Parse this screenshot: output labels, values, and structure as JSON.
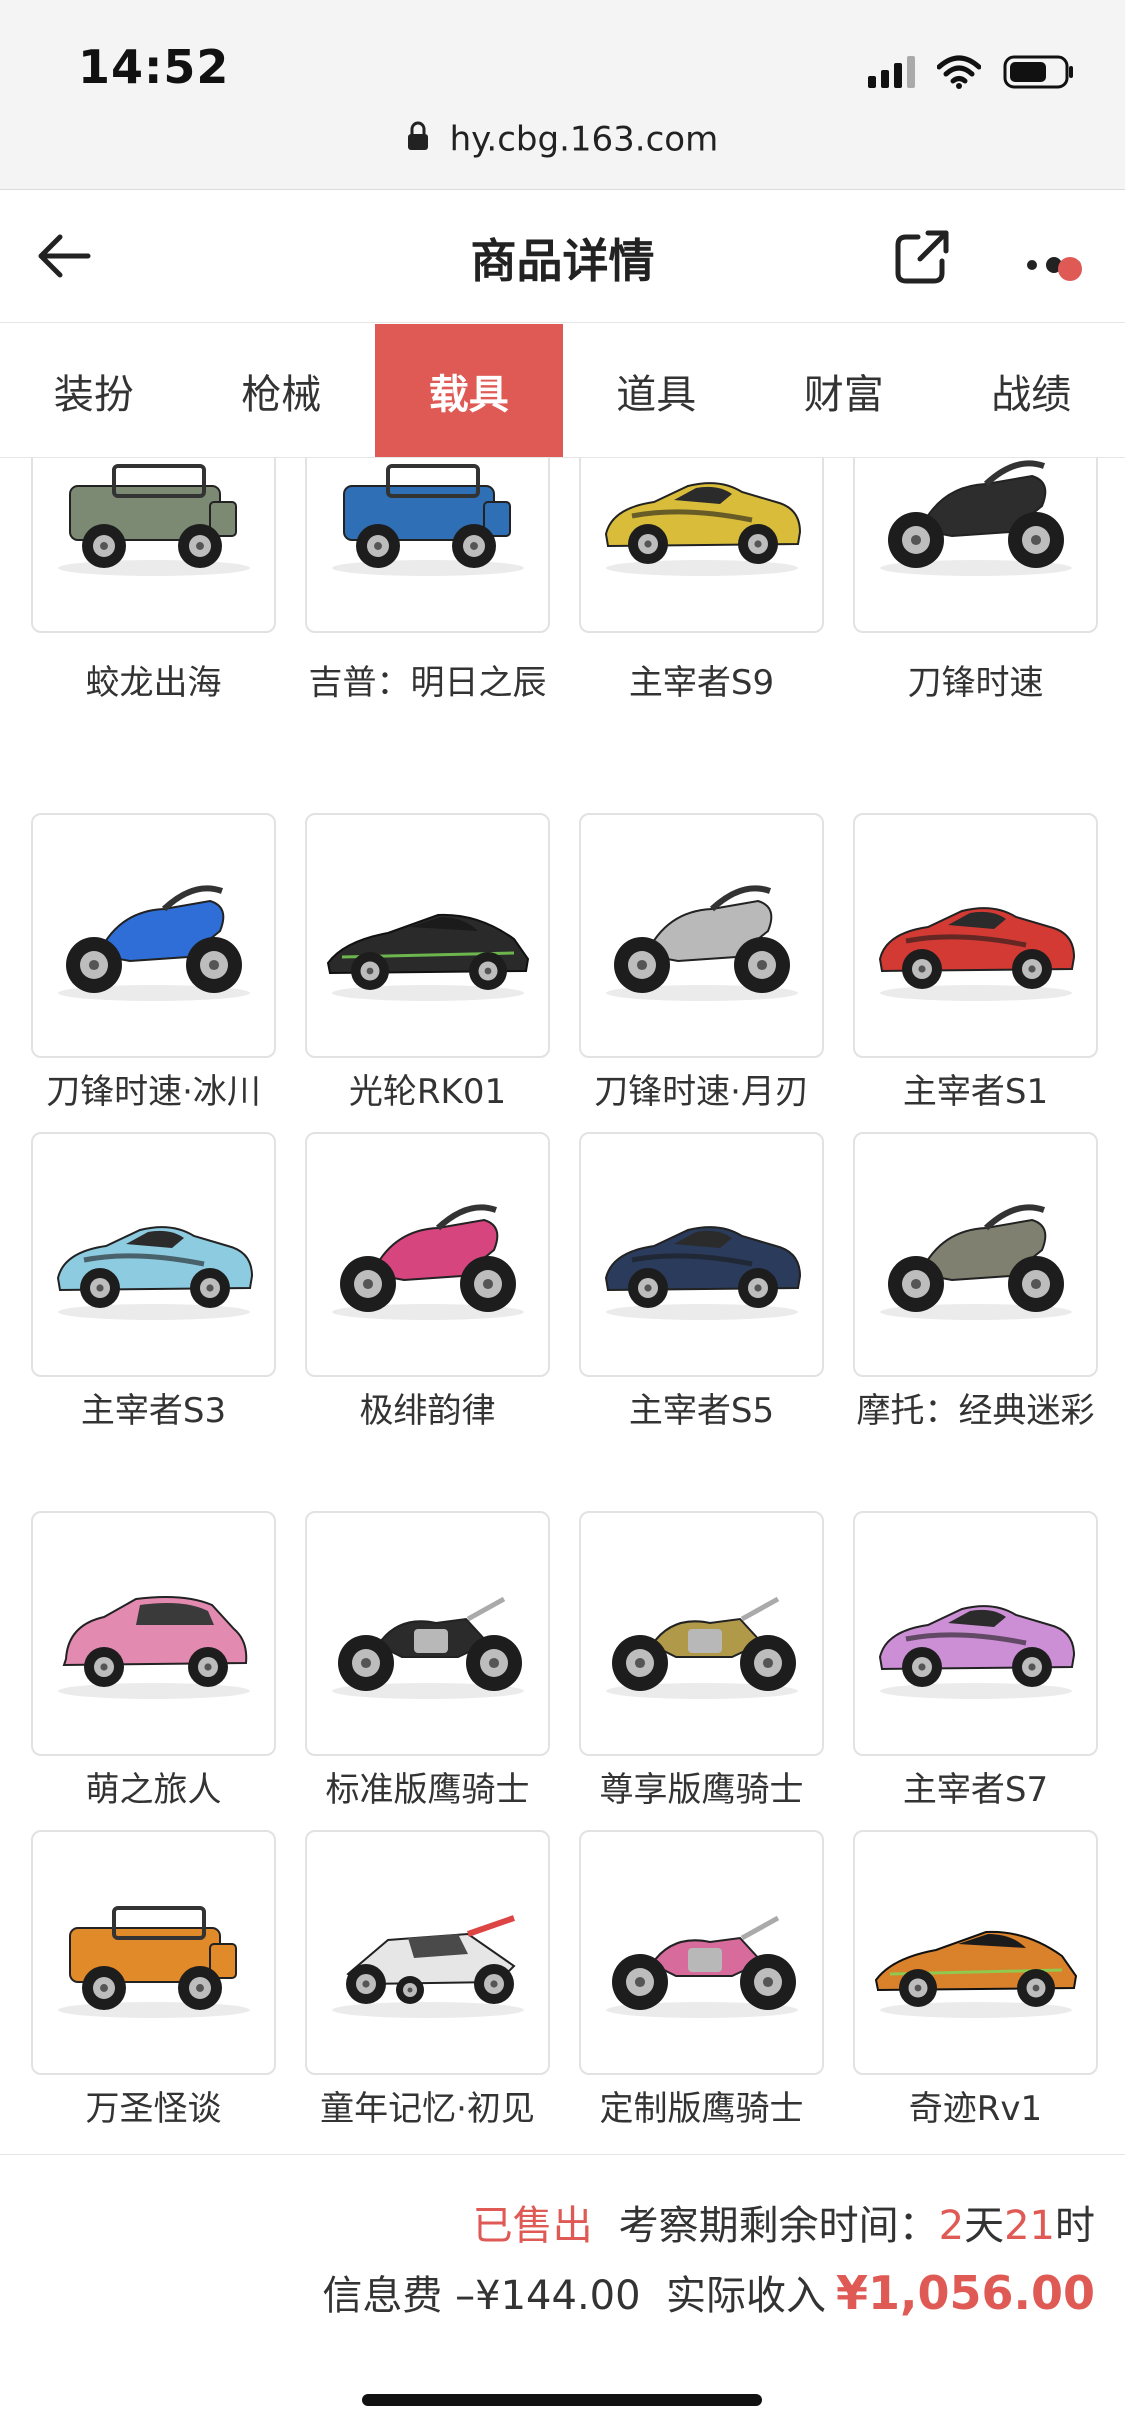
{
  "status": {
    "time": "14:52"
  },
  "browser": {
    "url": "hy.cbg.163.com"
  },
  "header": {
    "title": "商品详情"
  },
  "tabs": [
    {
      "label": "装扮",
      "active": false
    },
    {
      "label": "枪械",
      "active": false
    },
    {
      "label": "载具",
      "active": true
    },
    {
      "label": "道具",
      "active": false
    },
    {
      "label": "财富",
      "active": false
    },
    {
      "label": "战绩",
      "active": false
    }
  ],
  "vehicles": [
    {
      "name": "蛟龙出海",
      "icon": "camo-jeep-icon",
      "color": "#7c8a74",
      "kind": "jeep"
    },
    {
      "name": "吉普：明日之辰",
      "icon": "blue-jeep-icon",
      "color": "#2f6fb5",
      "kind": "jeep"
    },
    {
      "name": "主宰者S9",
      "icon": "yellow-sports-car-icon",
      "color": "#d9bd3a",
      "kind": "car"
    },
    {
      "name": "刀锋时速",
      "icon": "black-motorcycle-icon",
      "color": "#2d2d2d",
      "kind": "bike"
    },
    {
      "name": "刀锋时速·冰川",
      "icon": "blue-motorcycle-icon",
      "color": "#2e6ed6",
      "kind": "bike"
    },
    {
      "name": "光轮RK01",
      "icon": "green-supercar-icon",
      "color": "#2a2a2a",
      "kind": "super"
    },
    {
      "name": "刀锋时速·月刃",
      "icon": "silver-motorcycle-icon",
      "color": "#b9b9b9",
      "kind": "bike"
    },
    {
      "name": "主宰者S1",
      "icon": "red-sports-car-icon",
      "color": "#d33a34",
      "kind": "car"
    },
    {
      "name": "主宰者S3",
      "icon": "lightblue-sports-car-icon",
      "color": "#8dcbe0",
      "kind": "car"
    },
    {
      "name": "极绯韵律",
      "icon": "pink-motorcycle-icon",
      "color": "#d6457e",
      "kind": "bike"
    },
    {
      "name": "主宰者S5",
      "icon": "navy-sports-car-icon",
      "color": "#2a3b5c",
      "kind": "car"
    },
    {
      "name": "摩托：经典迷彩",
      "icon": "camo-motorcycle-icon",
      "color": "#7f806f",
      "kind": "bike"
    },
    {
      "name": "萌之旅人",
      "icon": "pink-minicar-icon",
      "color": "#e28ab0",
      "kind": "mini"
    },
    {
      "name": "标准版鹰骑士",
      "icon": "black-cruiser-icon",
      "color": "#2b2b2b",
      "kind": "cruiser"
    },
    {
      "name": "尊享版鹰骑士",
      "icon": "gold-cruiser-icon",
      "color": "#b09a4a",
      "kind": "cruiser"
    },
    {
      "name": "主宰者S7",
      "icon": "violet-sports-car-icon",
      "color": "#cc8fd6",
      "kind": "car"
    },
    {
      "name": "万圣怪谈",
      "icon": "orange-pickup-icon",
      "color": "#e08a2a",
      "kind": "jeep"
    },
    {
      "name": "童年记忆·初见",
      "icon": "kart-icon",
      "color": "#4a4a4a",
      "kind": "kart"
    },
    {
      "name": "定制版鹰骑士",
      "icon": "pink-cruiser-icon",
      "color": "#d66b9c",
      "kind": "cruiser"
    },
    {
      "name": "奇迹Rv1",
      "icon": "orange-supercar-icon",
      "color": "#d9822b",
      "kind": "super"
    }
  ],
  "footer": {
    "sold_label": "已售出",
    "period_label": "考察期剩余时间：",
    "days": "2",
    "days_unit": "天",
    "hours": "21",
    "hours_unit": "时",
    "fee_label": "信息费",
    "fee_value": "–¥144.00",
    "income_label": "实际收入",
    "income_value": "¥1,056.00"
  },
  "colors": {
    "accent": "#e05a55"
  }
}
